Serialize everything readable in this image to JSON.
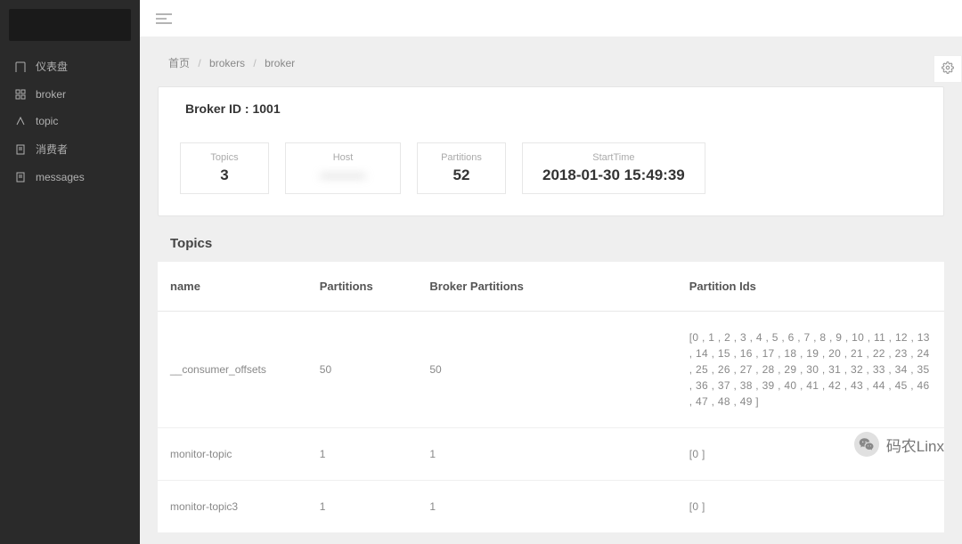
{
  "sidebar": {
    "items": [
      {
        "label": "仪表盘",
        "icon": "dashboard-icon"
      },
      {
        "label": "broker",
        "icon": "broker-icon"
      },
      {
        "label": "topic",
        "icon": "topic-icon"
      },
      {
        "label": "消费者",
        "icon": "consumer-icon"
      },
      {
        "label": "messages",
        "icon": "messages-icon"
      }
    ]
  },
  "breadcrumb": {
    "home": "首页",
    "brokers": "brokers",
    "broker": "broker"
  },
  "broker_card": {
    "title": "Broker ID : 1001",
    "stats": {
      "topics_label": "Topics",
      "topics_value": "3",
      "host_label": "Host",
      "host_value": "———",
      "partitions_label": "Partitions",
      "partitions_value": "52",
      "starttime_label": "StartTime",
      "starttime_value": "2018-01-30 15:49:39"
    }
  },
  "topics_section": {
    "title": "Topics",
    "columns": {
      "name": "name",
      "partitions": "Partitions",
      "broker_partitions": "Broker Partitions",
      "partition_ids": "Partition Ids"
    },
    "rows": [
      {
        "name": "__consumer_offsets",
        "partitions": "50",
        "broker_partitions": "50",
        "partition_ids": "[0 , 1 , 2 , 3 , 4 , 5 , 6 , 7 , 8 , 9 , 10 , 11 , 12 , 13 , 14 , 15 , 16 , 17 , 18 , 19 , 20 , 21 , 22 , 23 , 24 , 25 , 26 , 27 , 28 , 29 , 30 , 31 , 32 , 33 , 34 , 35 , 36 , 37 , 38 , 39 , 40 , 41 , 42 , 43 , 44 , 45 , 46 , 47 , 48 , 49 ]"
      },
      {
        "name": "monitor-topic",
        "partitions": "1",
        "broker_partitions": "1",
        "partition_ids": "[0 ]"
      },
      {
        "name": "monitor-topic3",
        "partitions": "1",
        "broker_partitions": "1",
        "partition_ids": "[0 ]"
      }
    ]
  },
  "watermark": "码农Linx"
}
